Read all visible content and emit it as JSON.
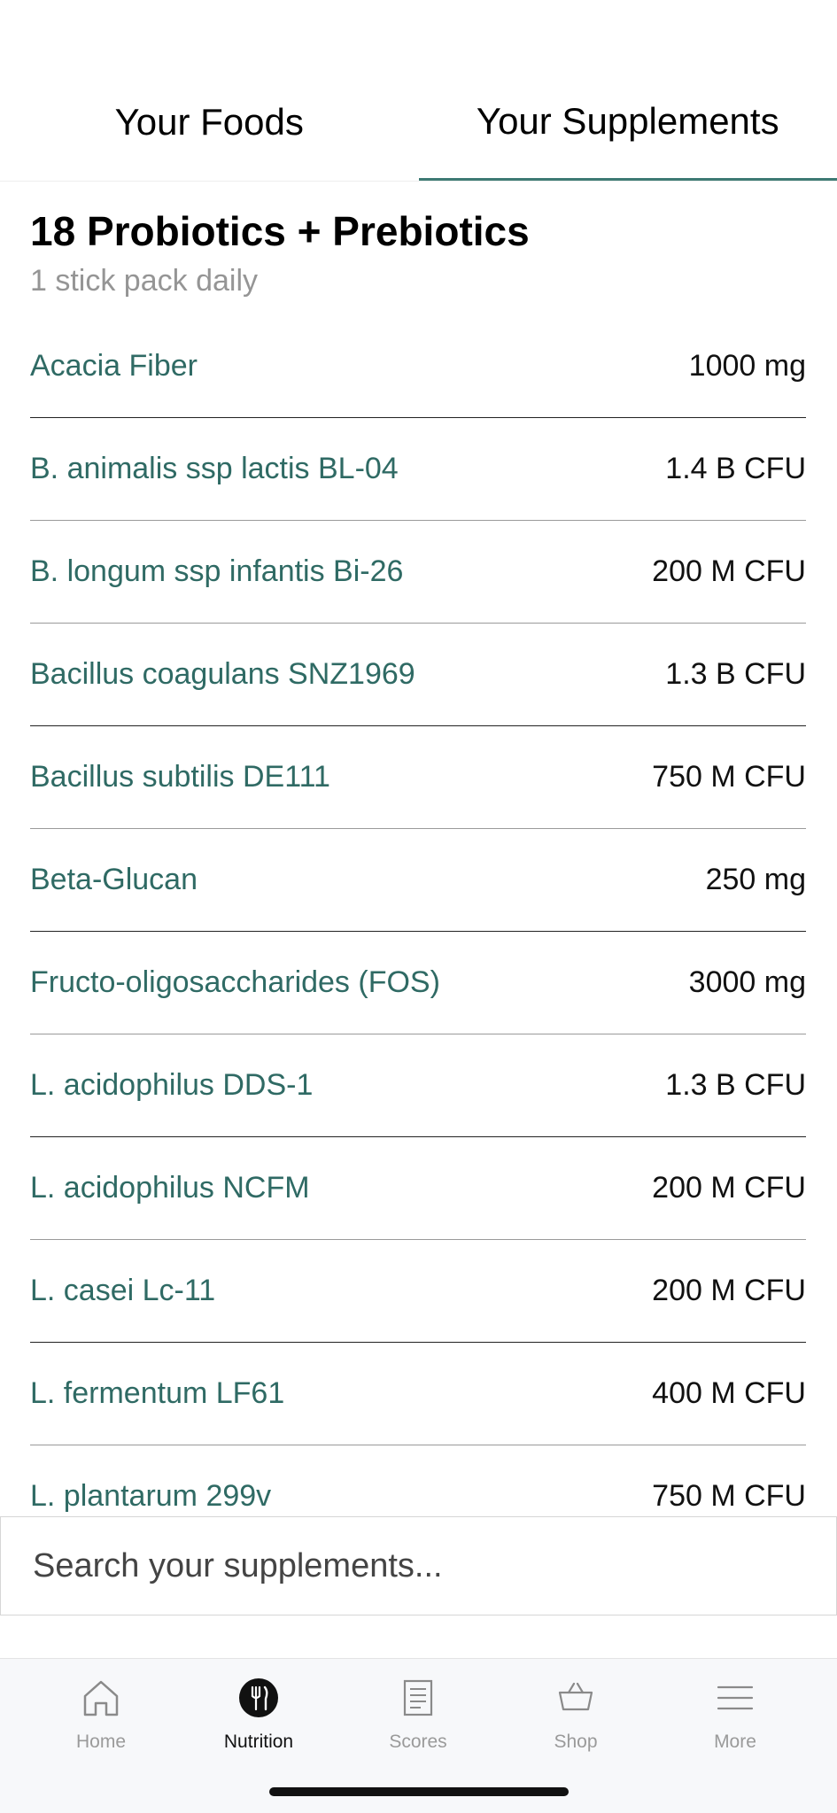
{
  "tabs": [
    {
      "label": "Your Foods"
    },
    {
      "label": "Your Supplements"
    }
  ],
  "supplement": {
    "title": "18 Probiotics + Prebiotics",
    "dosage": "1 stick pack daily",
    "ingredients": [
      {
        "name": "Acacia Fiber",
        "amount": "1000 mg"
      },
      {
        "name": "B. animalis ssp lactis BL-04",
        "amount": "1.4 B CFU"
      },
      {
        "name": "B. longum ssp infantis Bi-26",
        "amount": "200 M CFU"
      },
      {
        "name": "Bacillus coagulans SNZ1969",
        "amount": "1.3 B CFU"
      },
      {
        "name": "Bacillus subtilis DE111",
        "amount": "750 M CFU"
      },
      {
        "name": "Beta-Glucan",
        "amount": "250 mg"
      },
      {
        "name": "Fructo-oligosaccharides (FOS)",
        "amount": "3000 mg"
      },
      {
        "name": "L. acidophilus DDS-1",
        "amount": "1.3 B CFU"
      },
      {
        "name": "L. acidophilus NCFM",
        "amount": "200 M CFU"
      },
      {
        "name": "L. casei Lc-11",
        "amount": "200 M CFU"
      },
      {
        "name": "L. fermentum LF61",
        "amount": "400 M CFU"
      },
      {
        "name": "L. plantarum 299v",
        "amount": "750 M CFU"
      }
    ]
  },
  "search": {
    "placeholder": "Search your supplements..."
  },
  "tabbar": [
    {
      "label": "Home",
      "icon": "home-icon"
    },
    {
      "label": "Nutrition",
      "icon": "fork-knife-icon"
    },
    {
      "label": "Scores",
      "icon": "document-icon"
    },
    {
      "label": "Shop",
      "icon": "basket-icon"
    },
    {
      "label": "More",
      "icon": "menu-icon"
    }
  ],
  "colors": {
    "accent": "#3d7a73",
    "ingredient_text": "#2f6a64",
    "muted": "#959595",
    "tabbar_bg": "#f7f8fa"
  }
}
